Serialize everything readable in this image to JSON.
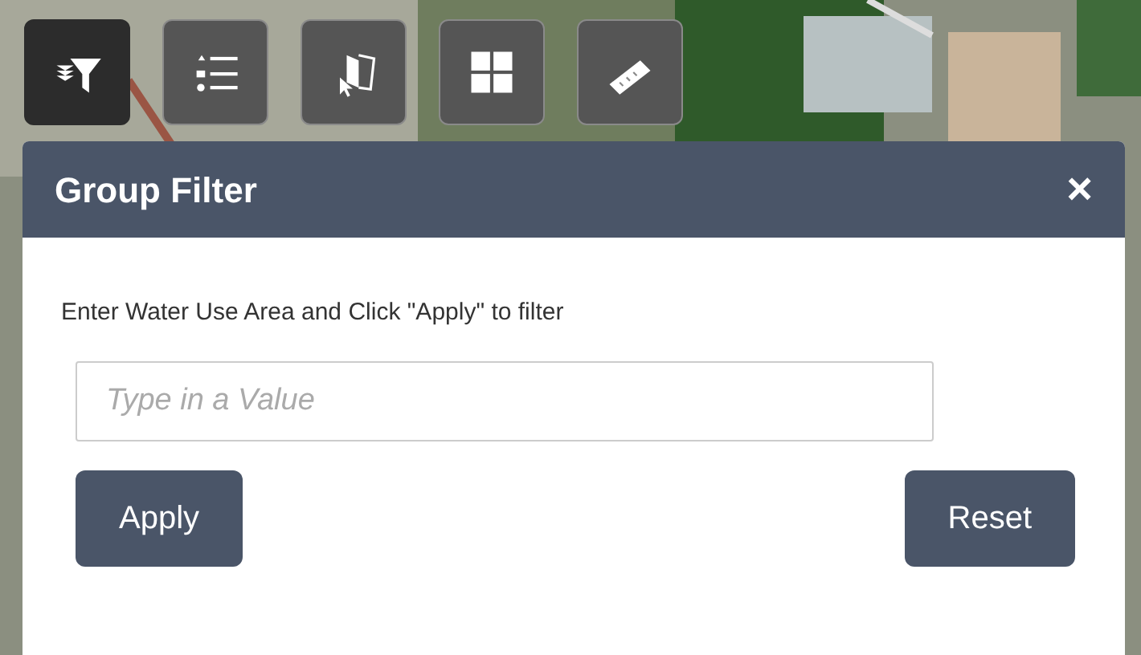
{
  "toolbar": [
    {
      "kind": "filter",
      "selected": true
    },
    {
      "kind": "list",
      "selected": false
    },
    {
      "kind": "select",
      "selected": false
    },
    {
      "kind": "grid",
      "selected": false
    },
    {
      "kind": "measure",
      "selected": false
    }
  ],
  "panel": {
    "title": "Group Filter",
    "close": "×",
    "instruction": "Enter Water Use Area and Click \"Apply\" to filter",
    "field": {
      "placeholder": "Type in a Value"
    },
    "buttons": [
      "Apply",
      "Reset"
    ]
  }
}
